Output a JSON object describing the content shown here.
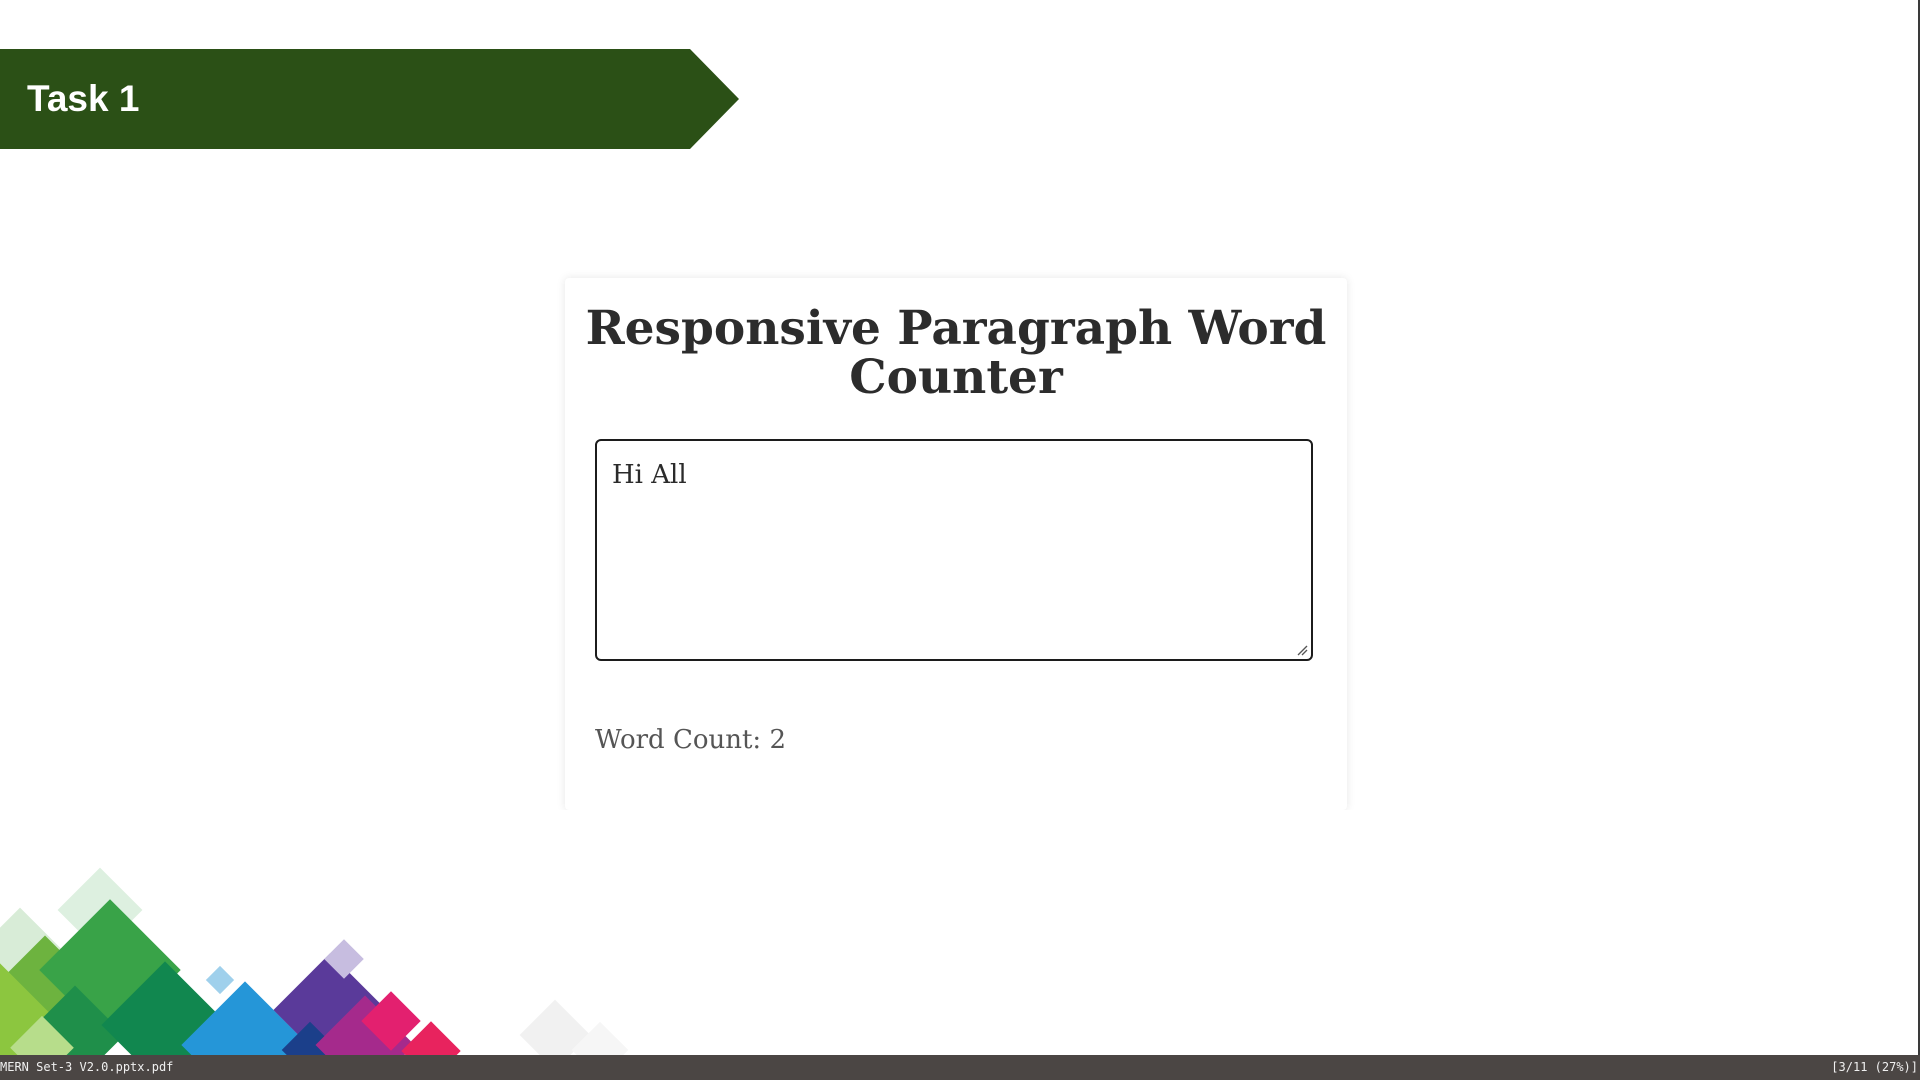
{
  "slide": {
    "task_title": "Task 1",
    "banner_color": "#2b5016"
  },
  "app": {
    "heading": "Responsive Paragraph Word Counter",
    "textarea_value": "Hi All",
    "word_count_label": "Word Count:",
    "word_count_value": "2"
  },
  "status_bar": {
    "filename": "MERN Set-3 V2.0.pptx.pdf",
    "page_info": "[3/11 (27%)]"
  },
  "icons": {
    "resize_grip": "resize-grip-icon",
    "decoration": "colorful-diamond-pattern"
  }
}
